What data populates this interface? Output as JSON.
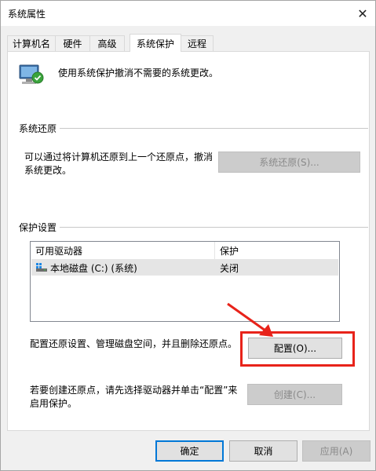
{
  "window": {
    "title": "系统属性"
  },
  "tabs": [
    {
      "label": "计算机名"
    },
    {
      "label": "硬件"
    },
    {
      "label": "高级"
    },
    {
      "label": "系统保护"
    },
    {
      "label": "远程"
    }
  ],
  "intro_text": "使用系统保护撤消不需要的系统更改。",
  "restore": {
    "group_label": "系统还原",
    "description_line1": "可以通过将计算机还原到上一个还原点，撤消",
    "description_line2": "系统更改。",
    "button_label": "系统还原(S)..."
  },
  "protection": {
    "group_label": "保护设置",
    "columns": [
      "可用驱动器",
      "保护"
    ],
    "rows": [
      {
        "drive": "本地磁盘 (C:) (系统)",
        "status": "关闭"
      }
    ],
    "configure_text": "配置还原设置、管理磁盘空间，并且删除还原点。",
    "configure_button": "配置(O)...",
    "create_text_line1": "若要创建还原点，请先选择驱动器并单击“配置”来",
    "create_text_line2": "启用保护。",
    "create_button": "创建(C)..."
  },
  "footer": {
    "ok": "确定",
    "cancel": "取消",
    "apply": "应用(A)"
  },
  "colors": {
    "accent": "#0078d7",
    "highlight": "#e8231a"
  }
}
